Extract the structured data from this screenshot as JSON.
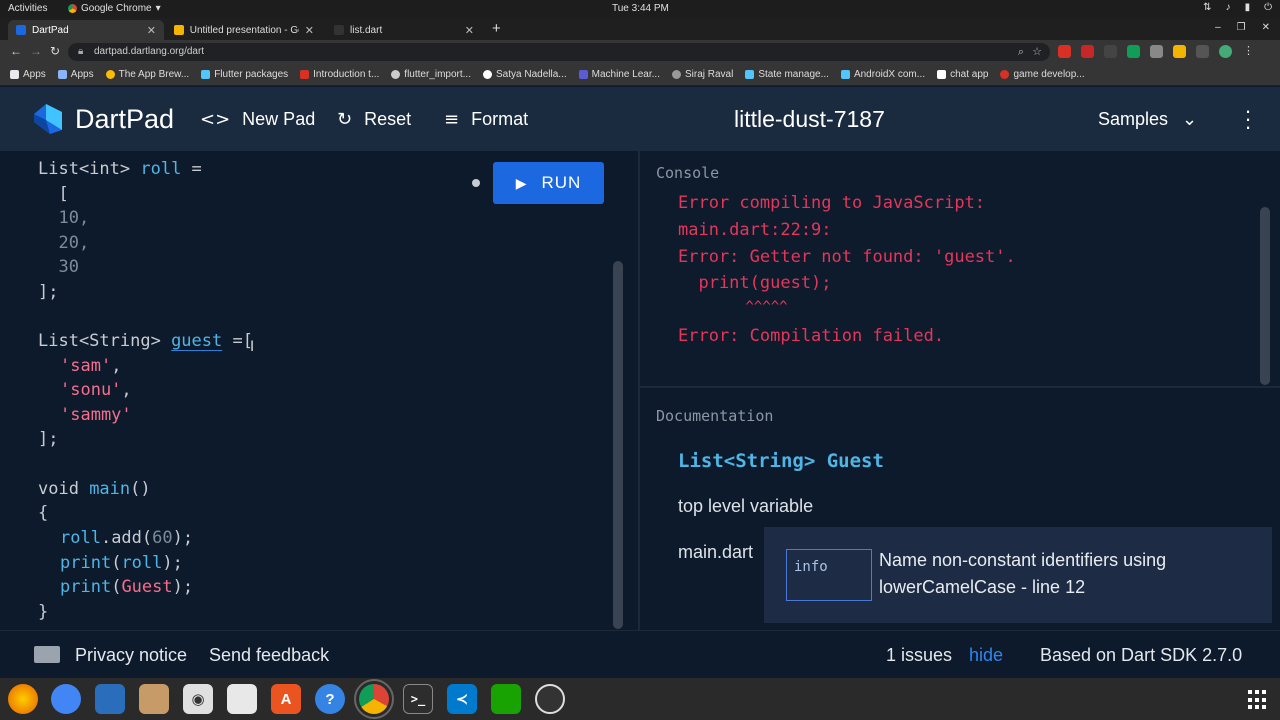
{
  "os_bar": {
    "activities": "Activities",
    "app_name": "Google Chrome",
    "clock": "Tue  3:44 PM"
  },
  "browser": {
    "tabs": [
      {
        "title": "DartPad",
        "active": true
      },
      {
        "title": "Untitled presentation - Go",
        "active": false
      },
      {
        "title": "list.dart",
        "active": false
      }
    ],
    "url": "dartpad.dartlang.org/dart",
    "bookmarks": [
      "Apps",
      "Apps",
      "The App Brew...",
      "Flutter packages",
      "Introduction t...",
      "flutter_import...",
      "Satya Nadella...",
      "Machine Lear...",
      "Siraj Raval",
      "State manage...",
      "AndroidX com...",
      "chat app",
      "game develop..."
    ]
  },
  "header": {
    "brand": "DartPad",
    "new_pad": "New Pad",
    "reset": "Reset",
    "format": "Format",
    "pad_name": "little-dust-7187",
    "samples": "Samples"
  },
  "editor": {
    "run_label": "RUN",
    "code": {
      "l1a": "List<int> ",
      "l1b": "roll",
      "l1c": " =",
      "l2": "  [",
      "l3": "  10,",
      "l4": "  20,",
      "l5": "  30",
      "l6": "];",
      "l7a": "List<String> ",
      "l7b": "guest",
      "l7c": " =[",
      "l8": "'sam'",
      "l9": "'sonu'",
      "l10": "'sammy'",
      "l11": "];",
      "l12a": "void ",
      "l12b": "main",
      "l12c": "()",
      "l13": "{",
      "l14a": "roll",
      "l14b": ".add(",
      "l14c": "60",
      "l14d": ");",
      "l15a": "print",
      "l15b": "(",
      "l15c": "roll",
      "l15d": ");",
      "l16a": "print",
      "l16b": "(",
      "l16c": "Guest",
      "l16d": ");",
      "l17": "}"
    }
  },
  "console": {
    "title": "Console",
    "lines": [
      "Error compiling to JavaScript:",
      "main.dart:22:9:",
      "Error: Getter not found: 'guest'.",
      "  print(guest);",
      "        ^^^^^",
      "Error: Compilation failed."
    ]
  },
  "documentation": {
    "title": "Documentation",
    "signature": "List<String> Guest",
    "kind": "top level variable",
    "source": "main.dart"
  },
  "issue_popup": {
    "severity": "info",
    "message": "Name non-constant identifiers using lowerCamelCase - line 12"
  },
  "footer": {
    "privacy": "Privacy notice",
    "feedback": "Send feedback",
    "issues_count": "1 issues",
    "hide": "hide",
    "sdk": "Based on Dart SDK 2.7.0"
  },
  "colors": {
    "accent": "#1c68e0",
    "error": "#e5365a",
    "keyword_blue": "#4fb5e6",
    "string_pink": "#f76e8c",
    "background": "#0d1a2b"
  }
}
